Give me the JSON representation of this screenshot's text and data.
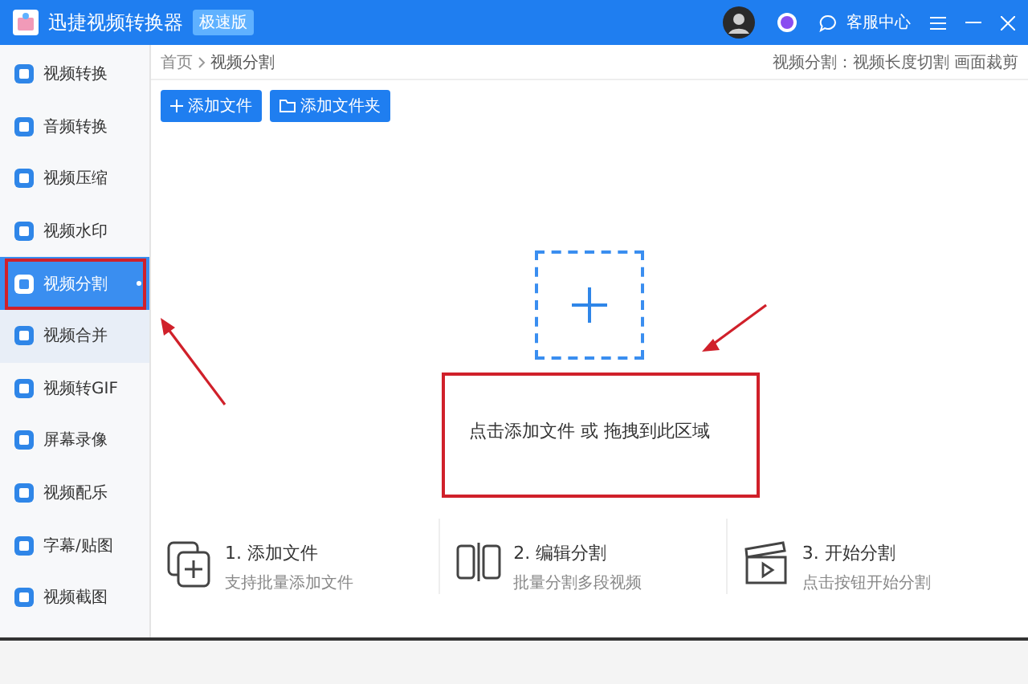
{
  "window": {
    "title": "迅捷视频转换器",
    "edition_badge": "极速版",
    "support_label": "客服中心"
  },
  "sidebar": {
    "items": [
      {
        "label": "视频转换",
        "selected": false,
        "hovered": false
      },
      {
        "label": "音频转换",
        "selected": false,
        "hovered": false
      },
      {
        "label": "视频压缩",
        "selected": false,
        "hovered": false
      },
      {
        "label": "视频水印",
        "selected": false,
        "hovered": false
      },
      {
        "label": "视频分割",
        "selected": true,
        "hovered": false
      },
      {
        "label": "视频合并",
        "selected": false,
        "hovered": true
      },
      {
        "label": "视频转GIF",
        "selected": false,
        "hovered": false
      },
      {
        "label": "屏幕录像",
        "selected": false,
        "hovered": false
      },
      {
        "label": "视频配乐",
        "selected": false,
        "hovered": false
      },
      {
        "label": "字幕/贴图",
        "selected": false,
        "hovered": false
      },
      {
        "label": "视频截图",
        "selected": false,
        "hovered": false
      }
    ]
  },
  "breadcrumb": {
    "home": "首页",
    "current": "视频分割"
  },
  "feature_hint": "视频分割：视频长度切割 画面裁剪",
  "toolbar": {
    "buttons": [
      "添加文件",
      "添加文件夹"
    ]
  },
  "dropzone": {
    "hint": "点击添加文件 或 拖拽到此区域"
  },
  "steps": [
    {
      "kind": "add",
      "title": "1. 添加文件",
      "subtitle": "支持批量添加文件"
    },
    {
      "kind": "edit",
      "title": "2. 编辑分割",
      "subtitle": "批量分割多段视频"
    },
    {
      "kind": "start",
      "title": "3. 开始分割",
      "subtitle": "点击按钮开始分割"
    }
  ]
}
